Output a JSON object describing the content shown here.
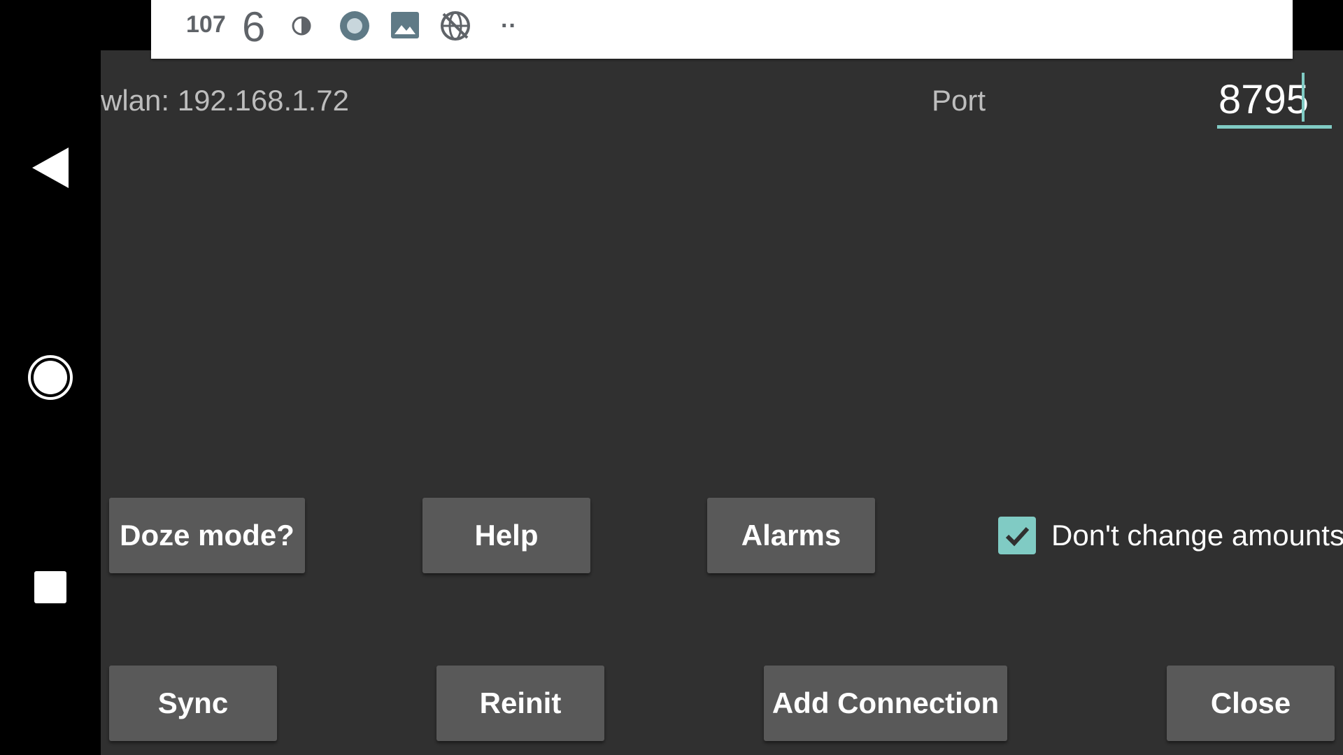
{
  "statusbar": {
    "count_small": "107",
    "count_big": "6",
    "icons": [
      "contrast-icon",
      "record-circle-icon",
      "image-icon",
      "network-off-icon",
      "more-dots-icon"
    ],
    "more": "··"
  },
  "navbar": {
    "icons": [
      "back-icon",
      "home-icon",
      "recents-icon"
    ]
  },
  "connection": {
    "wlan_label": "wlan: 192.168.1.72",
    "port_label": "Port",
    "port_value": "8795"
  },
  "buttons": {
    "doze": "Doze mode?",
    "help": "Help",
    "alarms": "Alarms",
    "sync": "Sync",
    "reinit": "Reinit",
    "add_connection": "Add Connection",
    "close": "Close"
  },
  "checkbox": {
    "label": "Don't change amounts",
    "checked": true
  },
  "colors": {
    "accent": "#80cbc4",
    "background": "#303030",
    "button": "#595959"
  }
}
